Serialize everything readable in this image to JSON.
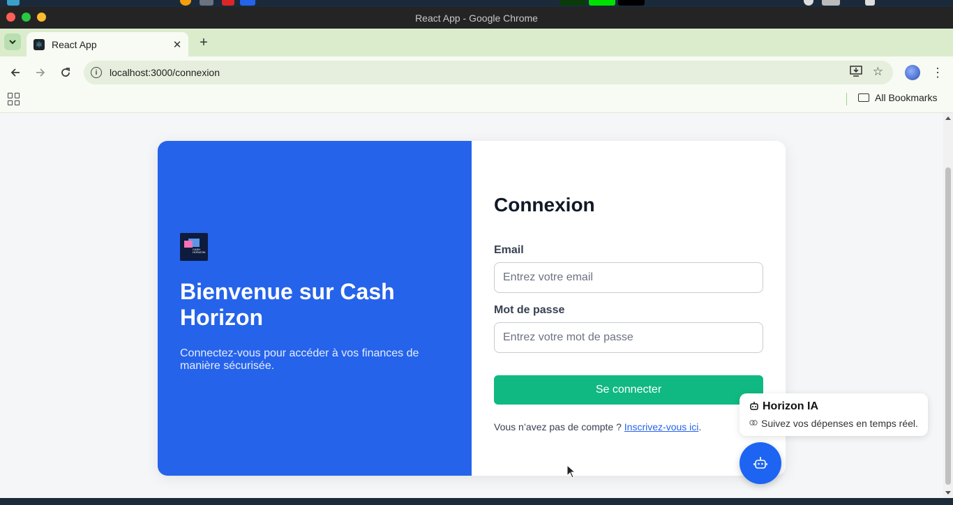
{
  "window": {
    "title": "React App - Google Chrome"
  },
  "tabs": [
    {
      "title": "React App",
      "close": "✕"
    }
  ],
  "toolbar": {
    "url": "localhost:3000/connexion",
    "new_tab": "+"
  },
  "bookmarks": {
    "all_label": "All Bookmarks"
  },
  "left_panel": {
    "logo_text": "CASH HORIZON",
    "heading": "Bienvenue sur Cash Horizon",
    "subtitle": "Connectez-vous pour accéder à vos finances de manière sécurisée."
  },
  "form": {
    "title": "Connexion",
    "email_label": "Email",
    "email_placeholder": "Entrez votre email",
    "password_label": "Mot de passe",
    "password_placeholder": "Entrez votre mot de passe",
    "submit_label": "Se connecter",
    "signup_text": "Vous n’avez pas de compte ? ",
    "signup_link": "Inscrivez-vous ici",
    "signup_end": "."
  },
  "chat": {
    "title": "Horizon IA",
    "message": "Suivez vos dépenses en temps réel."
  },
  "colors": {
    "primary_blue": "#2563eb",
    "success_green": "#10b981",
    "chat_blue": "#1d64f2"
  },
  "icons": [
    "close-icon",
    "back-arrow-icon",
    "forward-arrow-icon",
    "reload-icon",
    "info-icon",
    "install-icon",
    "star-icon",
    "kebab-menu-icon",
    "apps-grid-icon",
    "folder-icon",
    "robot-icon",
    "brain-icon"
  ]
}
